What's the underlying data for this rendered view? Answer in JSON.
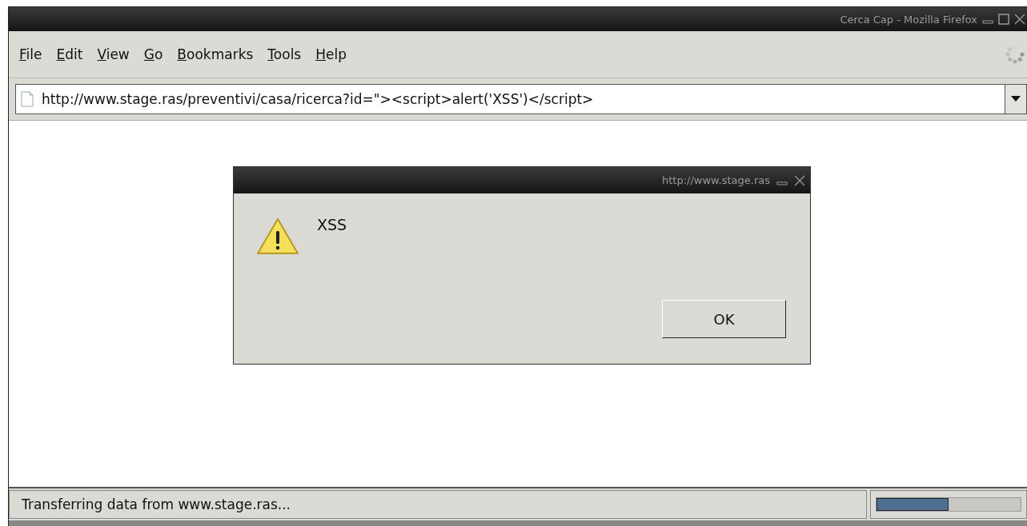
{
  "window": {
    "title": "Cerca Cap - Mozilla Firefox"
  },
  "menu": [
    {
      "label": "File"
    },
    {
      "label": "Edit"
    },
    {
      "label": "View"
    },
    {
      "label": "Go"
    },
    {
      "label": "Bookmarks"
    },
    {
      "label": "Tools"
    },
    {
      "label": "Help"
    }
  ],
  "address_bar": {
    "value": "http://www.stage.ras/preventivi/casa/ricerca?id=\"><script>alert('XSS')</script>"
  },
  "dialog": {
    "title": "http://www.stage.ras",
    "message": "XSS",
    "button": "OK"
  },
  "status_bar": {
    "text": "Transferring data from www.stage.ras...",
    "progress": {
      "level": 0.5
    }
  }
}
